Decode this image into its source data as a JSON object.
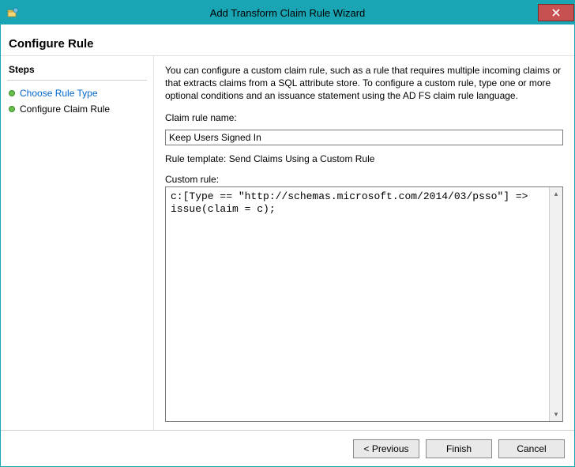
{
  "window": {
    "title": "Add Transform Claim Rule Wizard"
  },
  "header": {
    "title": "Configure Rule"
  },
  "sidebar": {
    "steps_label": "Steps",
    "items": [
      {
        "label": "Choose Rule Type"
      },
      {
        "label": "Configure Claim Rule"
      }
    ]
  },
  "main": {
    "description": "You can configure a custom claim rule, such as a rule that requires multiple incoming claims or that extracts claims from a SQL attribute store. To configure a custom rule, type one or more optional conditions and an issuance statement using the AD FS claim rule language.",
    "claim_rule_name_label": "Claim rule name:",
    "claim_rule_name_value": "Keep Users Signed In",
    "rule_template_line": "Rule template: Send Claims Using a Custom Rule",
    "custom_rule_label": "Custom rule:",
    "custom_rule_value": "c:[Type == \"http://schemas.microsoft.com/2014/03/psso\"] => issue(claim = c);"
  },
  "footer": {
    "previous": "< Previous",
    "finish": "Finish",
    "cancel": "Cancel"
  }
}
